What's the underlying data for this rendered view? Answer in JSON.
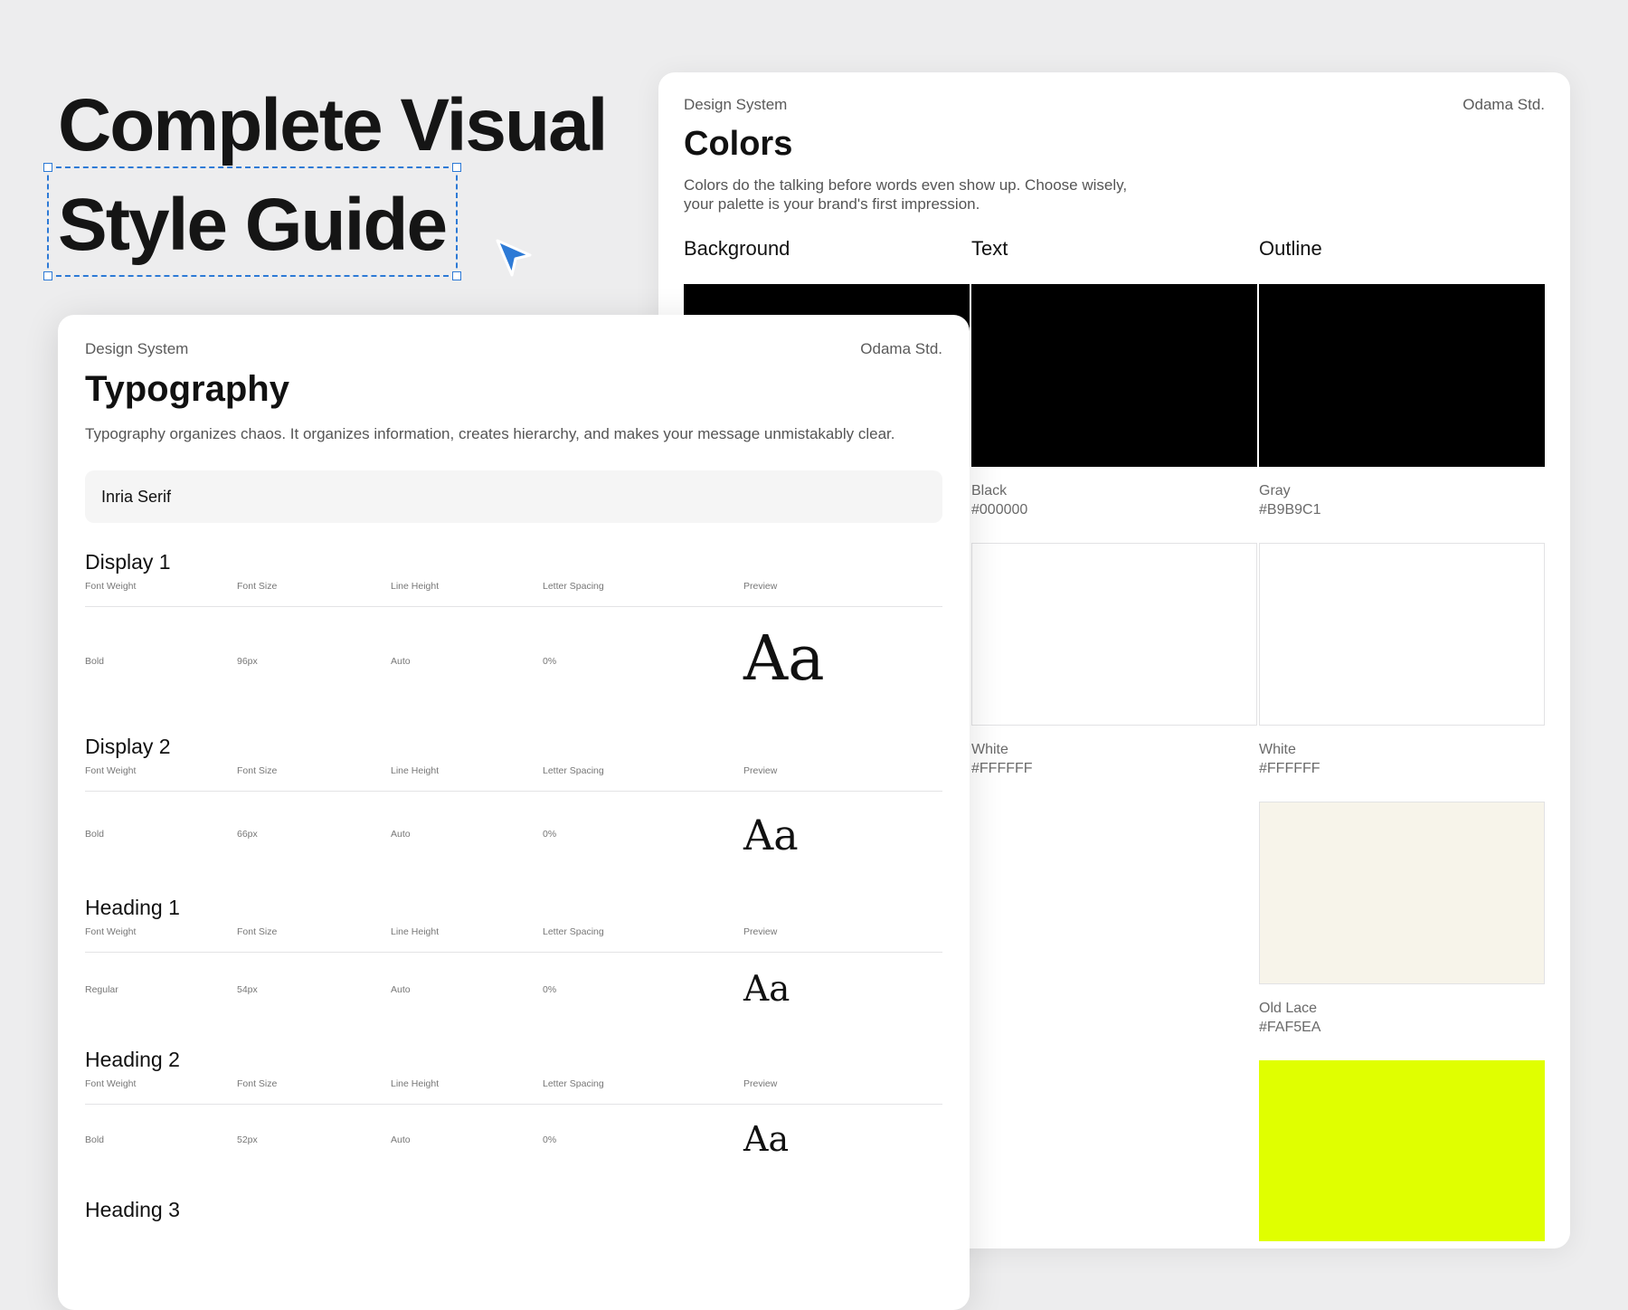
{
  "hero": {
    "line1": "Complete Visual",
    "line2": "Style Guide"
  },
  "colors_card": {
    "section": "Design System",
    "brand": "Odama Std.",
    "title": "Colors",
    "description": "Colors do the talking before words even show up. Choose wisely, your palette is your brand's first impression.",
    "columns": [
      "Background",
      "Text",
      "Outline"
    ],
    "swatches": {
      "text_black": {
        "name": "Black",
        "hex": "#000000",
        "color": "#000000"
      },
      "outline_gray": {
        "name": "Gray",
        "hex": "#B9B9C1",
        "color": "#000000"
      },
      "text_white": {
        "name": "White",
        "hex": "#FFFFFF",
        "color": "#FFFFFF"
      },
      "outline_white": {
        "name": "White",
        "hex": "#FFFFFF",
        "color": "#FFFFFF"
      },
      "old_lace": {
        "name": "Old Lace",
        "hex": "#FAF5EA",
        "color": "#F7F4EA"
      },
      "lime": {
        "color": "#E0FF00"
      },
      "bg_black": {
        "color": "#000000"
      }
    }
  },
  "typography_card": {
    "section": "Design System",
    "brand": "Odama Std.",
    "title": "Typography",
    "description": "Typography organizes chaos. It organizes information, creates hierarchy, and makes your message unmistakably clear.",
    "font_name": "Inria Serif",
    "headers": [
      "Font Weight",
      "Font Size",
      "Line Height",
      "Letter Spacing",
      "Preview"
    ],
    "styles": [
      {
        "name": "Display 1",
        "weight": "Bold",
        "size": "96px",
        "line_height": "Auto",
        "letter_spacing": "0%",
        "preview": "Aa"
      },
      {
        "name": "Display 2",
        "weight": "Bold",
        "size": "66px",
        "line_height": "Auto",
        "letter_spacing": "0%",
        "preview": "Aa"
      },
      {
        "name": "Heading 1",
        "weight": "Regular",
        "size": "54px",
        "line_height": "Auto",
        "letter_spacing": "0%",
        "preview": "Aa"
      },
      {
        "name": "Heading 2",
        "weight": "Bold",
        "size": "52px",
        "line_height": "Auto",
        "letter_spacing": "0%",
        "preview": "Aa"
      },
      {
        "name": "Heading 3"
      }
    ]
  },
  "icons": {
    "cursor": "cursor-arrow-icon"
  },
  "accent_color": "#2D7AD6"
}
